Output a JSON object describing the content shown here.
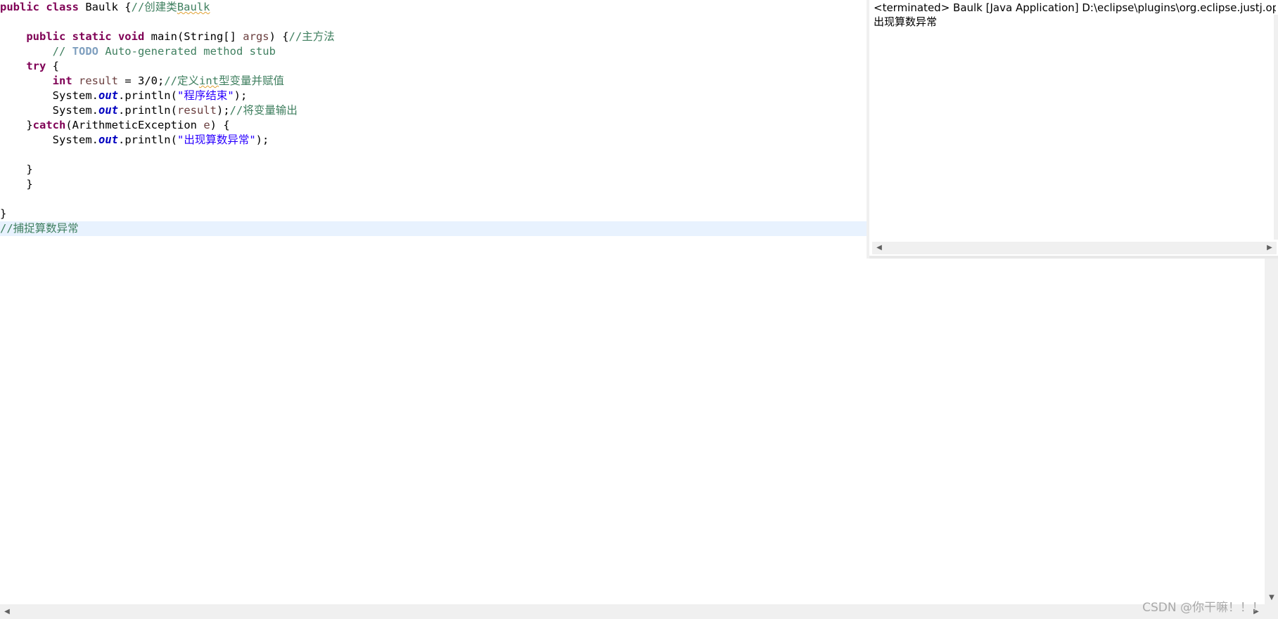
{
  "editor": {
    "lines": [
      [
        {
          "t": "public class",
          "c": "kw"
        },
        {
          "t": " Baulk {"
        },
        {
          "t": "//创建类",
          "c": "cm"
        },
        {
          "t": "Baulk",
          "c": "cm sq"
        }
      ],
      [],
      [
        {
          "t": "    "
        },
        {
          "t": "public static void",
          "c": "kw"
        },
        {
          "t": " main(String[] "
        },
        {
          "t": "args",
          "c": "var"
        },
        {
          "t": ") {"
        },
        {
          "t": "//主方法",
          "c": "cm"
        }
      ],
      [
        {
          "t": "        "
        },
        {
          "t": "// ",
          "c": "cm"
        },
        {
          "t": "TODO",
          "c": "todo"
        },
        {
          "t": " Auto-generated method stub",
          "c": "cm"
        }
      ],
      [
        {
          "t": "    "
        },
        {
          "t": "try",
          "c": "kw"
        },
        {
          "t": " {"
        }
      ],
      [
        {
          "t": "        "
        },
        {
          "t": "int",
          "c": "kw"
        },
        {
          "t": " "
        },
        {
          "t": "result",
          "c": "var"
        },
        {
          "t": " = 3/0;"
        },
        {
          "t": "//定义",
          "c": "cm"
        },
        {
          "t": "int",
          "c": "cm sq"
        },
        {
          "t": "型变量并赋值",
          "c": "cm"
        }
      ],
      [
        {
          "t": "        System."
        },
        {
          "t": "out",
          "c": "fld"
        },
        {
          "t": ".println("
        },
        {
          "t": "\"程序结束\"",
          "c": "str"
        },
        {
          "t": ");"
        }
      ],
      [
        {
          "t": "        System."
        },
        {
          "t": "out",
          "c": "fld"
        },
        {
          "t": ".println("
        },
        {
          "t": "result",
          "c": "var"
        },
        {
          "t": ");"
        },
        {
          "t": "//将变量输出",
          "c": "cm"
        }
      ],
      [
        {
          "t": "    }"
        },
        {
          "t": "catch",
          "c": "kw"
        },
        {
          "t": "(ArithmeticException "
        },
        {
          "t": "e",
          "c": "var"
        },
        {
          "t": ") {"
        }
      ],
      [
        {
          "t": "        System."
        },
        {
          "t": "out",
          "c": "fld"
        },
        {
          "t": ".println("
        },
        {
          "t": "\"出现算数异常\"",
          "c": "str"
        },
        {
          "t": ");"
        }
      ],
      [],
      [
        {
          "t": "    }"
        }
      ],
      [
        {
          "t": "    }"
        }
      ],
      [],
      [
        {
          "t": "}"
        }
      ],
      [
        {
          "t": "//捕捉算数异常",
          "c": "cm"
        }
      ]
    ],
    "current_line": 16
  },
  "console": {
    "title": "<terminated> Baulk [Java Application] D:\\eclipse\\plugins\\org.eclipse.justj.openjdk.hotspot.jre.full.win32.x86_64",
    "output": "出现算数异常"
  },
  "icons": {
    "left_arrow": "◀",
    "right_arrow": "▶",
    "up_arrow": "▲",
    "down_arrow": "▼"
  },
  "watermark": "CSDN @你干嘛！！！"
}
